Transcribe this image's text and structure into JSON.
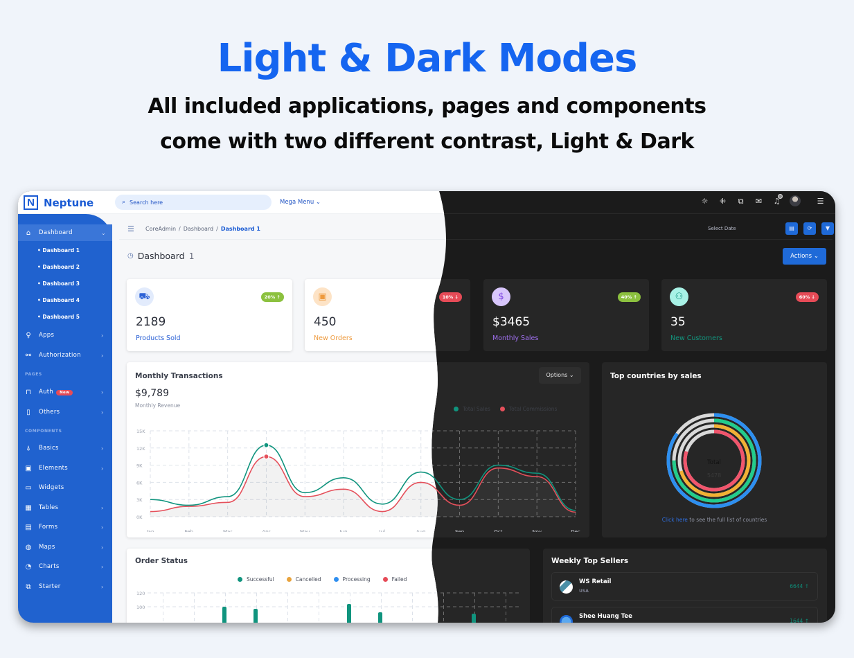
{
  "hero": {
    "title": "Light & Dark Modes",
    "subtitle_line1": "All included applications, pages and components",
    "subtitle_line2": "come with two different contrast, Light & Dark"
  },
  "app": {
    "brand": "Neptune",
    "brand_letter": "N",
    "search_placeholder": "Search here",
    "mega_menu": "Mega Menu ⌄",
    "top_icons": [
      "sun-icon",
      "compress-icon",
      "translate-icon",
      "mail-icon",
      "bell-icon",
      "avatar",
      "sliders-icon"
    ]
  },
  "sidebar": {
    "dashboard": "Dashboard",
    "sub_items": [
      "Dashboard 1",
      "Dashboard 2",
      "Dashboard 3",
      "Dashboard 4",
      "Dashboard 5"
    ],
    "apps": "Apps",
    "authorization": "Authorization",
    "section_pages": "PAGES",
    "auth": "Auth",
    "auth_badge": "New",
    "others": "Others",
    "section_components": "COMPONENTS",
    "basics": "Basics",
    "elements": "Elements",
    "widgets": "Widgets",
    "tables": "Tables",
    "forms": "Forms",
    "maps": "Maps",
    "charts": "Charts",
    "starter": "Starter"
  },
  "breadcrumb": {
    "items": [
      "CoreAdmin",
      "/",
      "Dashboard",
      "/"
    ],
    "current": "Dashboard 1",
    "select_date": "Select Date"
  },
  "page": {
    "title": "Dashboard",
    "title_suffix": "1",
    "actions": "Actions ⌄"
  },
  "stats": [
    {
      "value": "2189",
      "label": "Products Sold",
      "change": "20% ↑",
      "color": "#2c62d6",
      "pill": "#8cc13f"
    },
    {
      "value": "450",
      "label": "New Orders",
      "change": "10% ↓",
      "color": "#ee9a3d",
      "pill": "#e64b57"
    },
    {
      "value": "$3465",
      "label": "Monthly Sales",
      "change": "40% ↑",
      "color": "#a070f0",
      "pill": "#8cc13f"
    },
    {
      "value": "35",
      "label": "New Customers",
      "change": "60% ↓",
      "color": "#12967f",
      "pill": "#e64b57"
    }
  ],
  "transactions": {
    "title": "Monthly Transactions",
    "amount": "$9,789",
    "subtitle": "Monthly Revenue",
    "options": "Options ⌄",
    "legend": [
      "Total Sales",
      "Total Commissions"
    ]
  },
  "countries": {
    "title": "Top countries by sales",
    "center_label": "Total",
    "center_value": "5478",
    "footer_link": "Click here",
    "footer_text": " to see the full list of countries"
  },
  "orders": {
    "title": "Order Status",
    "legend": [
      "Successful",
      "Cancelled",
      "Processing",
      "Failed"
    ],
    "legend_colors": [
      "#10947e",
      "#e8a33d",
      "#2f8ff0",
      "#e64b57"
    ],
    "yticks": [
      "120",
      "100"
    ]
  },
  "sellers": {
    "title": "Weekly Top Sellers",
    "items": [
      {
        "name": "WS Retail",
        "country": "USA",
        "value": "6644 ↑"
      },
      {
        "name": "Shee Huang Tee",
        "country": "",
        "value": "1644 ↑"
      }
    ]
  },
  "chart_data": [
    {
      "type": "line",
      "title": "Monthly Transactions",
      "categories": [
        "Jan",
        "Feb",
        "Mar",
        "Apr",
        "May",
        "Jun",
        "Jul",
        "Aug",
        "Sep",
        "Oct",
        "Nov",
        "Dec"
      ],
      "yticks": [
        "0K",
        "3K",
        "6K",
        "9K",
        "12K",
        "15K"
      ],
      "ylim": [
        0,
        15000
      ],
      "grid": true,
      "legend": "top-right",
      "series": [
        {
          "name": "Total Sales",
          "color": "#10947e",
          "values": [
            3000,
            2000,
            3500,
            12500,
            4200,
            6800,
            2200,
            7800,
            3000,
            9000,
            7600,
            1100
          ]
        },
        {
          "name": "Total Commissions",
          "color": "#e5505b",
          "values": [
            900,
            1800,
            2500,
            10500,
            3500,
            4800,
            900,
            6000,
            2000,
            8500,
            7000,
            800
          ]
        }
      ]
    },
    {
      "type": "radial-bar",
      "title": "Top countries by sales",
      "center": {
        "label": "Total",
        "value": 5478
      },
      "series": [
        {
          "color": "#2d8ff0",
          "percent": 85
        },
        {
          "color": "#22cc8c",
          "percent": 75
        },
        {
          "color": "#f2b134",
          "percent": 70
        },
        {
          "color": "#f1556c",
          "percent": 80
        }
      ]
    },
    {
      "type": "bar",
      "title": "Order Status",
      "legend": [
        "Successful",
        "Cancelled",
        "Processing",
        "Failed"
      ],
      "yticks": [
        "100",
        "120"
      ],
      "series": [
        {
          "name": "Successful",
          "values": [
            null,
            null,
            100,
            97,
            null,
            null,
            104,
            92,
            null,
            null,
            90,
            null
          ]
        }
      ]
    }
  ]
}
